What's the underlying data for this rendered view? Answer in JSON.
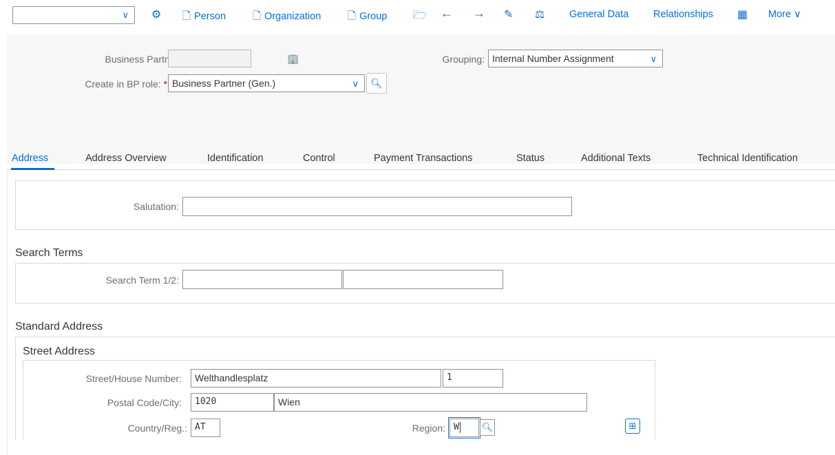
{
  "toolbar": {
    "select_value": "",
    "person": "Person",
    "organization": "Organization",
    "group": "Group",
    "general_data": "General Data",
    "relationships": "Relationships",
    "more": "More"
  },
  "header": {
    "bp_label": "Business Partner:",
    "bp_value": "",
    "grouping_label": "Grouping:",
    "grouping_value": "Internal Number Assignment",
    "role_label": "Create in BP role:",
    "role_required": "*",
    "role_value": "Business Partner (Gen.)"
  },
  "tabs": [
    {
      "label": "Address",
      "active": true
    },
    {
      "label": "Address Overview"
    },
    {
      "label": "Identification"
    },
    {
      "label": "Control"
    },
    {
      "label": "Payment Transactions"
    },
    {
      "label": "Status"
    },
    {
      "label": "Additional Texts"
    },
    {
      "label": "Technical Identification"
    }
  ],
  "salutation": {
    "label": "Salutation:",
    "value": ""
  },
  "search_terms": {
    "title": "Search Terms",
    "label": "Search Term 1/2:",
    "term1": "",
    "term2": ""
  },
  "standard_address": {
    "title": "Standard Address",
    "street_address_title": "Street Address",
    "street_label": "Street/House Number:",
    "street_value": "Welthandlesplatz",
    "house_value": "1",
    "postal_label": "Postal Code/City:",
    "postal_value": "1020",
    "city_value": "Wien",
    "country_label": "Country/Reg.:",
    "country_value": "AT",
    "region_label": "Region:",
    "region_value": "W"
  },
  "colors": {
    "accent": "#0a6ed1",
    "required": "#bb0000"
  }
}
